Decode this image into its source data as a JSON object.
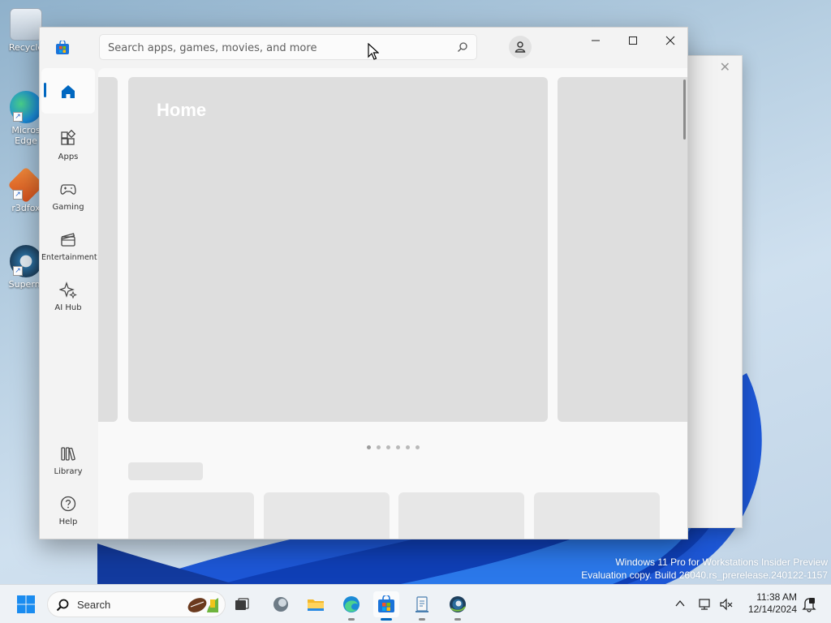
{
  "desktop": {
    "icons": [
      {
        "label": "Recycle"
      },
      {
        "label": "Micros Edge"
      },
      {
        "label": "r3dfox"
      },
      {
        "label": "Superm"
      }
    ],
    "watermark": {
      "line1": "Windows 11 Pro for Workstations Insider Preview",
      "line2": "Evaluation copy. Build 26040.rs_prerelease.240122-1157"
    }
  },
  "store": {
    "search_placeholder": "Search apps, games, movies, and more",
    "nav": [
      {
        "label": "",
        "icon": "home-icon",
        "active": true
      },
      {
        "label": "Apps",
        "icon": "apps-icon"
      },
      {
        "label": "Gaming",
        "icon": "gamepad-icon"
      },
      {
        "label": "Entertainment",
        "icon": "clapper-icon"
      },
      {
        "label": "AI Hub",
        "icon": "sparkle-icon"
      }
    ],
    "nav_bottom": [
      {
        "label": "Library",
        "icon": "library-icon"
      },
      {
        "label": "Help",
        "icon": "help-icon"
      }
    ],
    "hero_title": "Home",
    "carousel": {
      "count": 6,
      "active": 0
    },
    "accent": "#0067c0"
  },
  "taskbar": {
    "search_label": "Search",
    "apps": [
      "start-icon",
      "task-view-icon",
      "widgets-icon",
      "file-explorer-icon",
      "edge-icon",
      "store-icon",
      "notepad-icon",
      "r3dfox-icon"
    ],
    "time": "11:38 AM",
    "date": "12/14/2024"
  }
}
